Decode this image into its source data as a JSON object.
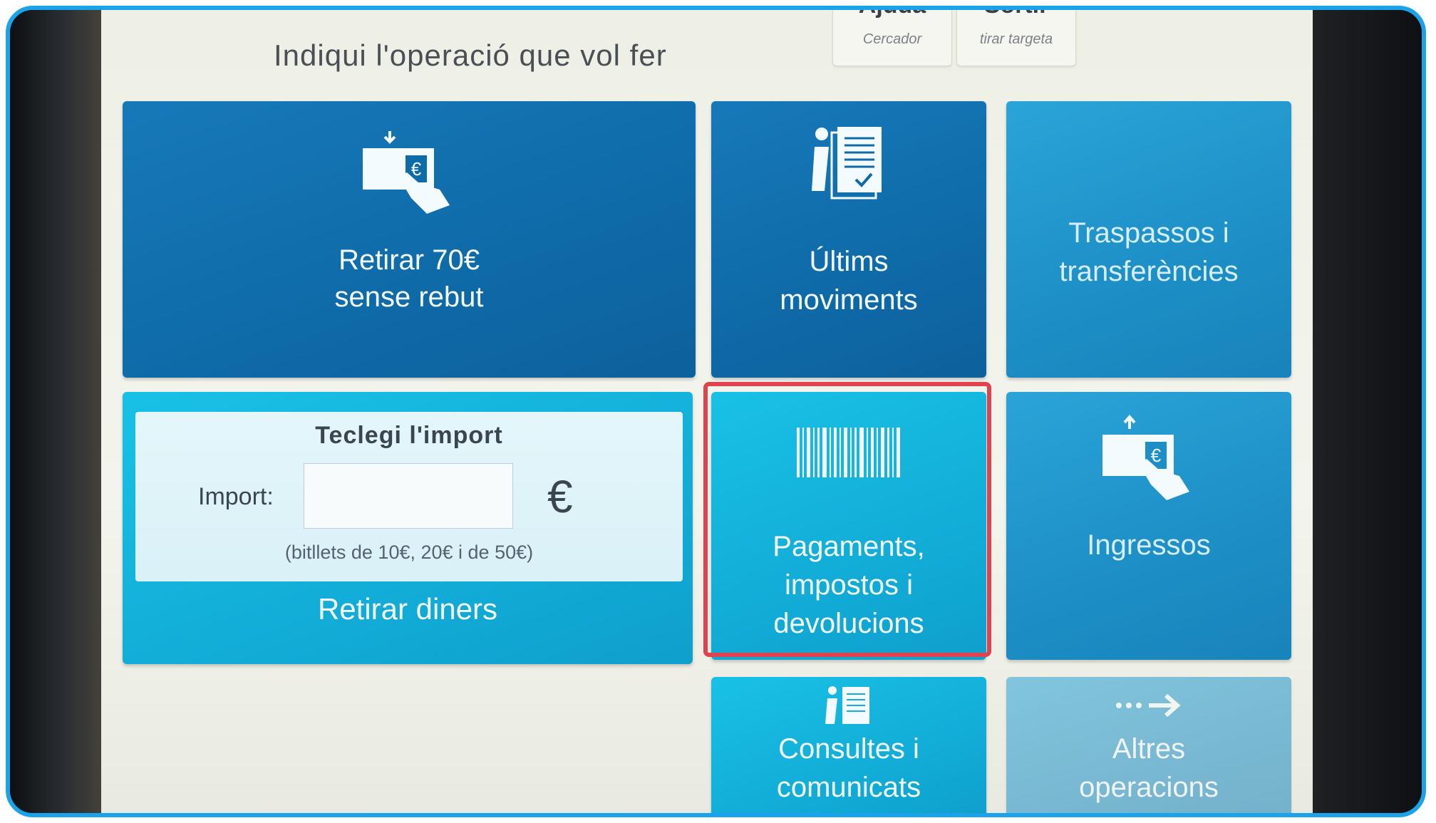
{
  "header": {
    "prompt": "Indiqui l'operació que vol fer",
    "help_button": {
      "label": "Ajuda",
      "sub": "Cercador"
    },
    "exit_button": {
      "label": "Sortir",
      "sub": "tirar targeta"
    }
  },
  "tiles": {
    "withdraw_fast": {
      "line1": "Retirar 70€",
      "line2": "sense rebut",
      "icon": "cash-withdraw-icon"
    },
    "last_movements": {
      "line1": "Últims",
      "line2": "moviments",
      "icon": "info-document-icon"
    },
    "transfers": {
      "line1": "Traspassos i",
      "line2": "transferències"
    },
    "withdraw_money": {
      "panel_title": "Teclegi l'import",
      "import_label": "Import:",
      "import_value": "",
      "currency": "€",
      "note": "(bitllets de 10€, 20€ i de 50€)",
      "label": "Retirar diners"
    },
    "payments": {
      "line1": "Pagaments,",
      "line2": "impostos i",
      "line3": "devolucions",
      "icon": "barcode-icon"
    },
    "deposits": {
      "label": "Ingressos",
      "icon": "cash-deposit-icon"
    },
    "queries": {
      "line1": "Consultes i",
      "line2": "comunicats",
      "icon": "info-document-icon"
    },
    "other_ops": {
      "line1": "Altres",
      "line2": "operacions",
      "icon": "arrow-right-icon"
    }
  },
  "colors": {
    "frame": "#1aa3e8",
    "highlight": "#e0434d",
    "tile_dark": "#0f6aa8",
    "tile_mid": "#1d8fc6",
    "tile_cyan": "#12add8"
  }
}
